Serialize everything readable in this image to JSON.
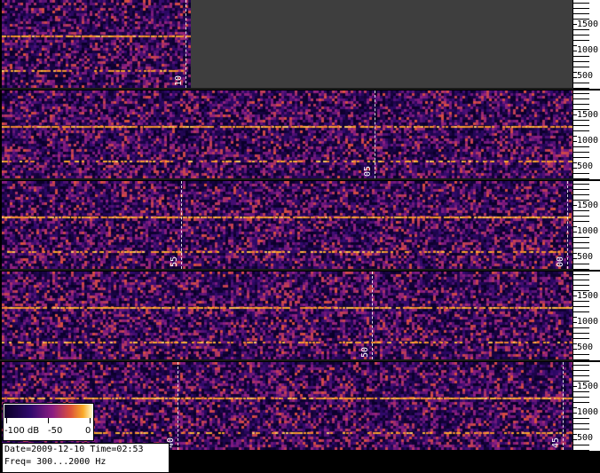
{
  "chart_data": {
    "type": "heatmap",
    "subtype": "spectrogram waterfall",
    "freq_axis_ticks": [
      "1500",
      "1000",
      "500"
    ],
    "colorbar": {
      "labels": [
        "-100 dB",
        "-50",
        "0"
      ],
      "range_db": [
        -100,
        0
      ]
    },
    "strips": [
      {
        "minute_labels": [
          "10"
        ]
      },
      {
        "minute_labels": [
          "05"
        ]
      },
      {
        "minute_labels": [
          "55",
          "00"
        ]
      },
      {
        "minute_labels": [
          "50"
        ]
      },
      {
        "minute_labels": [
          "40",
          "45"
        ]
      }
    ],
    "tones_hz": [
      1300,
      620
    ],
    "freq_range_hz": [
      300,
      2000
    ]
  },
  "info": {
    "line1": "Date=2009-12-10 Time=02:53",
    "line2": "Freq= 300...2000 Hz"
  },
  "colors": {
    "background": "#1b0a3a",
    "empty": "#3e3e3e",
    "hot": "#ffa020"
  }
}
